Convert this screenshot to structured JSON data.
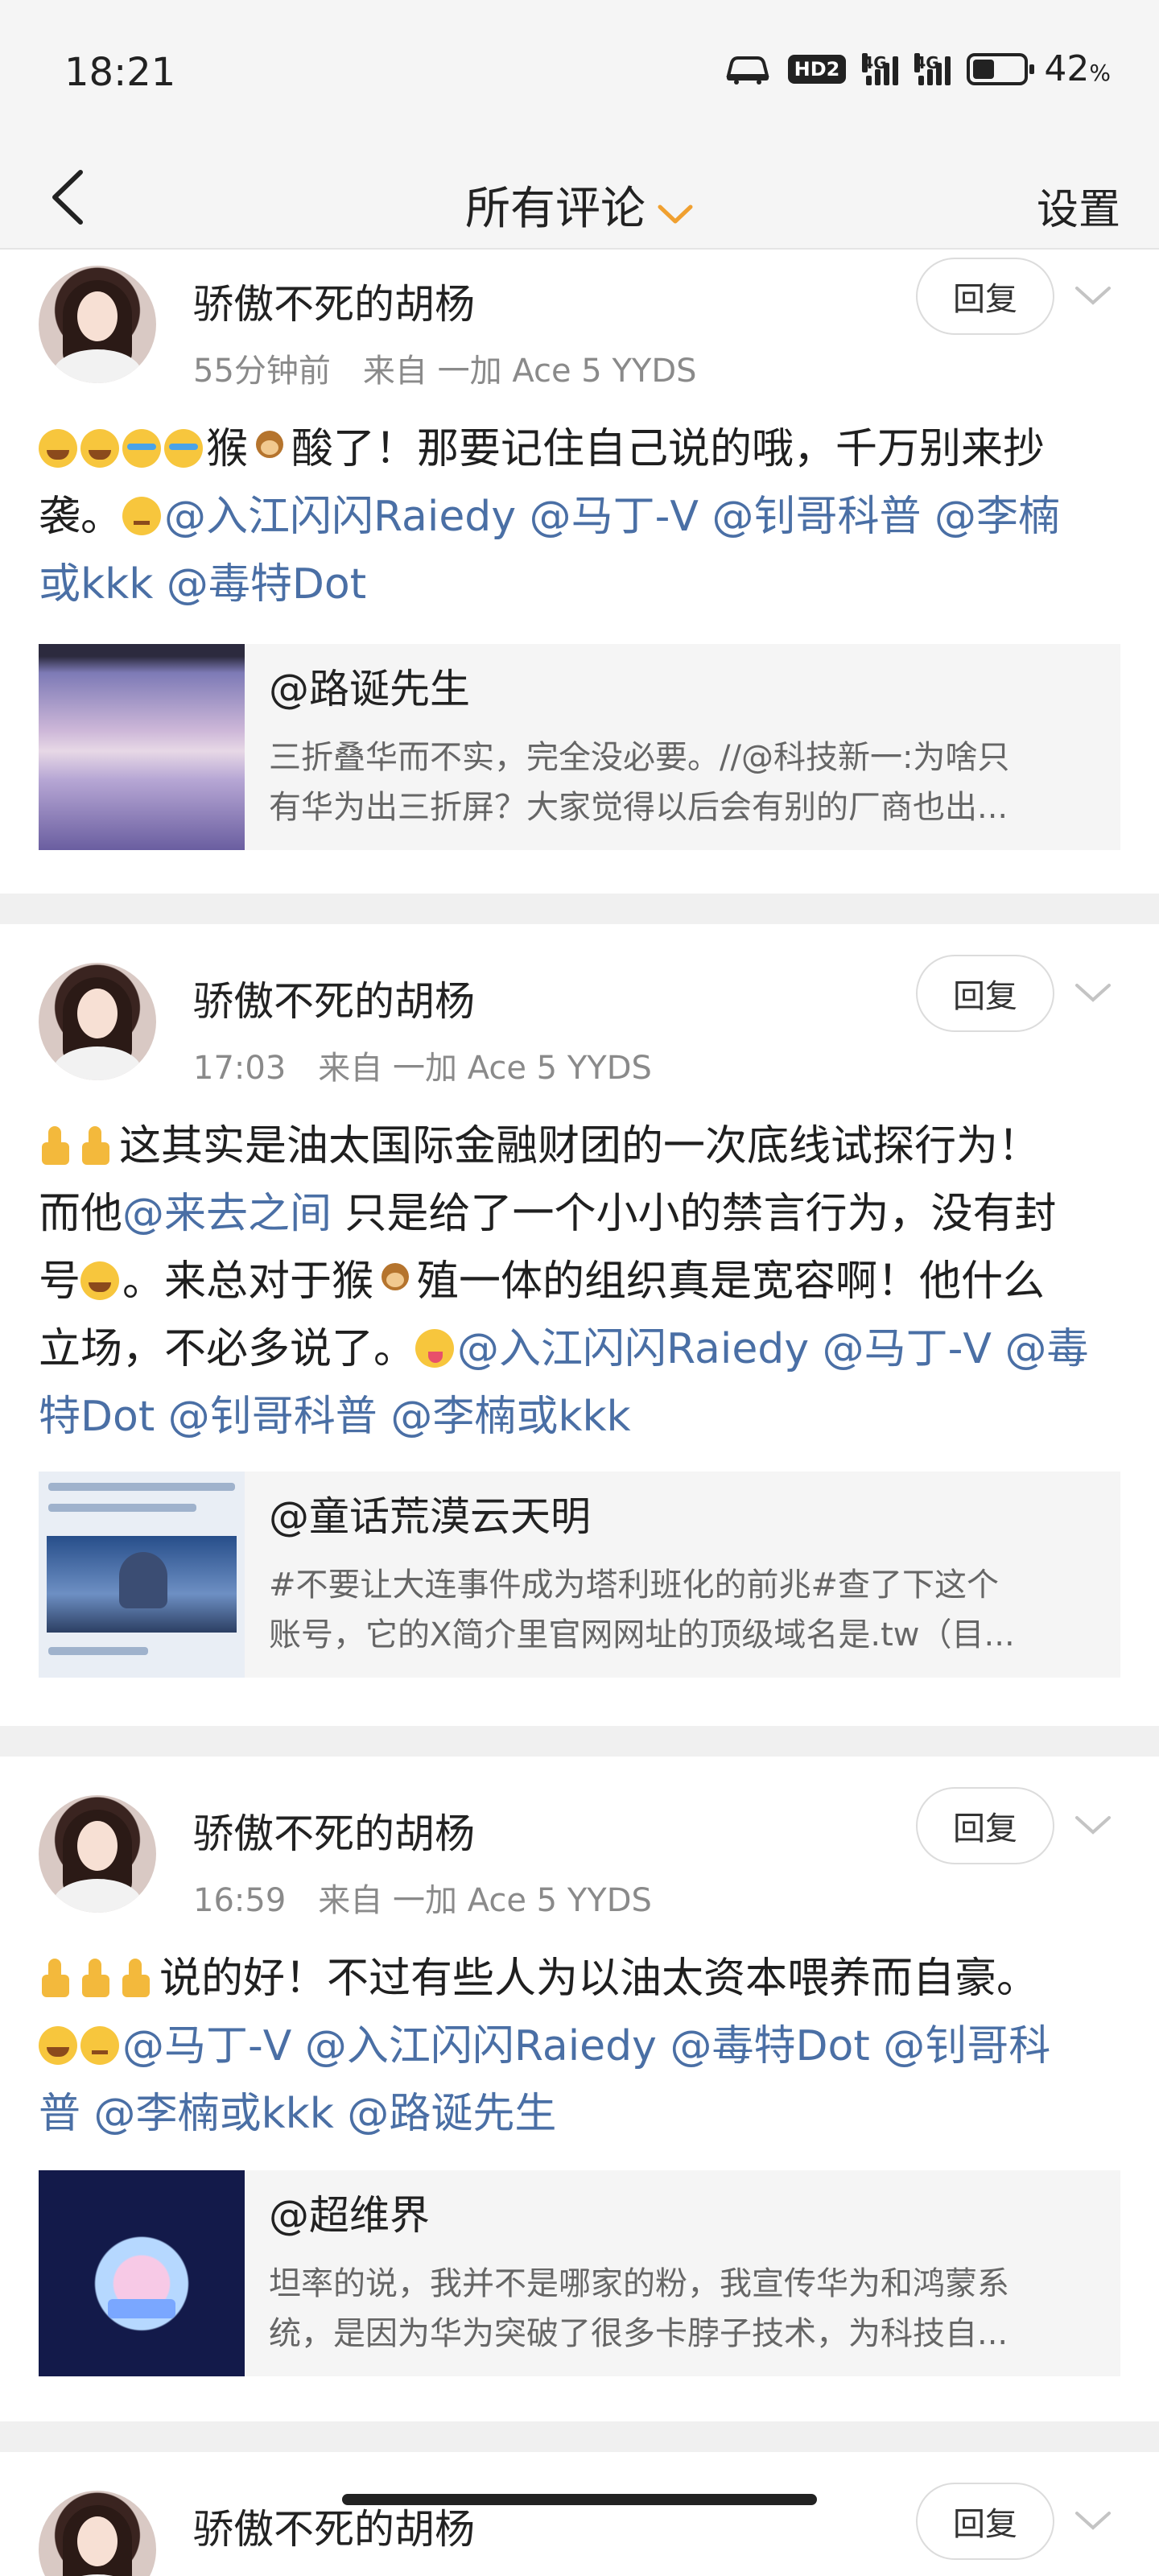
{
  "status_bar": {
    "time": "18:21",
    "hd_badge": "HD2",
    "signal_1_label": "4G",
    "signal_2_label": "4G",
    "battery_percent": "42",
    "battery_unit": "%",
    "battery_level": 0.42
  },
  "nav": {
    "title": "所有评论",
    "settings": "设置"
  },
  "posts": [
    {
      "author": "骄傲不死的胡杨",
      "meta": "55分钟前　来自 一加 Ace 5 YYDS",
      "reply": "回复",
      "text_1": "猴",
      "text_2": "酸了！那要记住自己说的哦，千万别来抄",
      "text_3": "袭。",
      "mention_1": "@入江闪闪Raiedy",
      "mention_2": "@马丁-V",
      "mention_3": "@钊哥科普",
      "mention_4": "@李楠",
      "mention_5": "或kkk",
      "mention_6": "@毒特Dot",
      "quote_user": "@路诞先生",
      "quote_line_1": "三折叠华而不实，完全没必要。//@科技新一:为啥只",
      "quote_line_2": "有华为出三折屏？大家觉得以后会有别的厂商也出..."
    },
    {
      "author": "骄傲不死的胡杨",
      "meta": "17:03　来自 一加 Ace 5 YYDS",
      "reply": "回复",
      "text_1": "这其实是油太国际金融财团的一次底线试探行为！",
      "text_2": "而他",
      "mention_inline": "@来去之间",
      "text_3": " 只是给了一个小小的禁言行为，没有封",
      "text_4": "号",
      "text_5": "。来总对于猴",
      "text_6": "殖一体的组织真是宽容啊！他什么",
      "text_7": "立场，不必多说了。",
      "mention_1": "@入江闪闪Raiedy",
      "mention_2": "@马丁-V",
      "mention_3": "@毒",
      "mention_4": "特Dot",
      "mention_5": "@钊哥科普",
      "mention_6": "@李楠或kkk",
      "quote_user": "@童话荒漠云天明",
      "quote_line_1": "#不要让大连事件成为塔利班化的前兆#查了下这个",
      "quote_line_2": "账号，它的X简介里官网网址的顶级域名是.tw（目..."
    },
    {
      "author": "骄傲不死的胡杨",
      "meta": "16:59　来自 一加 Ace 5 YYDS",
      "reply": "回复",
      "text_1": "说的好！不过有些人为以油太资本喂养而自豪。",
      "mention_1": "@马丁-V",
      "mention_2": "@入江闪闪Raiedy",
      "mention_3": "@毒特Dot",
      "mention_4": "@钊哥科",
      "mention_5": "普",
      "mention_6": "@李楠或kkk",
      "mention_7": "@路诞先生",
      "quote_user": "@超维界",
      "quote_line_1": "坦率的说，我并不是哪家的粉，我宣传华为和鸿蒙系",
      "quote_line_2": "统，是因为华为突破了很多卡脖子技术，为科技自..."
    },
    {
      "author": "骄傲不死的胡杨",
      "reply": "回复"
    }
  ],
  "colors": {
    "mention": "#4a6fa5",
    "accent_chevron": "#f0a030",
    "divider": "#f0f0f0"
  }
}
